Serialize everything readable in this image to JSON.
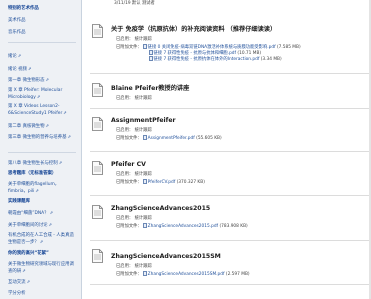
{
  "sidebar": {
    "items": [
      {
        "label": "特别的艺术作品",
        "heading": true,
        "ext": false
      },
      {
        "label": "美术作品",
        "heading": false,
        "ext": false
      },
      {
        "label": "音乐作品",
        "heading": false,
        "ext": false
      },
      {
        "label": "绪论",
        "heading": false,
        "ext": true
      },
      {
        "label": "绪论 视频",
        "heading": false,
        "ext": true
      },
      {
        "label": "第一章 微生物形态",
        "heading": false,
        "ext": true
      },
      {
        "label": "第 X 章 Pfeifer: Molecular Microbiology",
        "heading": false,
        "ext": true
      },
      {
        "label": "第 X 章 Videos Lesson2-6&ScienceStudy1 Pfeifer",
        "heading": false,
        "ext": true
      },
      {
        "label": "第二章 真核微生物",
        "heading": false,
        "ext": true
      },
      {
        "label": "第三章 微生物的营养与培养基",
        "heading": false,
        "ext": true
      },
      {
        "label": "第八章 微生物生长与控制",
        "heading": false,
        "ext": true
      },
      {
        "label": "思考题库（无标准答案）",
        "heading": true,
        "ext": false
      },
      {
        "label": "关于单细胞的flagellum，fimbria，pili",
        "heading": false,
        "ext": true
      },
      {
        "label": "实践课题库",
        "heading": true,
        "ext": false
      },
      {
        "label": "朝霞由“细菌”DNA？",
        "heading": false,
        "ext": true
      },
      {
        "label": "关于单细胞间的讨论",
        "heading": false,
        "ext": true
      },
      {
        "label": "有机合成的在人工合成 - 人类真造生物是否一步？",
        "heading": false,
        "ext": true
      },
      {
        "label": "你的我的高兴“花絮”",
        "heading": true,
        "ext": false
      },
      {
        "label": "关于微生物研究领域与现行应用调查的研",
        "heading": false,
        "ext": true
      },
      {
        "label": "互动交流",
        "heading": false,
        "ext": true
      },
      {
        "label": "学分分析",
        "heading": false,
        "ext": false
      }
    ]
  },
  "main": {
    "date_line": "3/11/19 默认 测试者",
    "entries": [
      {
        "title": "关于 免疫学（抗原抗体）的补充阅读资料 （推荐仔细读读）",
        "status_label": "已启用：",
        "status_value": "统计跟踪",
        "attach_label": "已附加文件：",
        "files": [
          {
            "name": "链接 0 关闭免疫-病毒双链DNA激活补体系统与质膜功能受影响.pdf",
            "size": "(7.585 MB)"
          },
          {
            "name": "链接 7 获得性免疫 - 抗原与抗体和细胞.pdf",
            "size": "(10.71 MB)"
          },
          {
            "name": "链接 7 获得性免疫 - 抗原抗体在体外的Interaction.pdf",
            "size": "(3.34 MB)"
          }
        ]
      },
      {
        "title": "Blaine Pfeifer教授的讲座",
        "status_label": "已启用：",
        "status_value": "统计跟踪",
        "attach_label": "",
        "files": []
      },
      {
        "title": "AssignmentPfeifer",
        "status_label": "已启用：",
        "status_value": "统计跟踪",
        "attach_label": "已附加文件：",
        "files": [
          {
            "name": "AssignmentPfeifer.pdf",
            "size": "(55.605 KB)"
          }
        ]
      },
      {
        "title": "Pfeifer CV",
        "status_label": "已启用：",
        "status_value": "统计跟踪",
        "attach_label": "已附加文件：",
        "files": [
          {
            "name": "PfeiferCV.pdf",
            "size": "(370.327 KB)"
          }
        ]
      },
      {
        "title": "ZhangScienceAdvances2015",
        "status_label": "已启用：",
        "status_value": "统计跟踪",
        "attach_label": "已附加文件：",
        "files": [
          {
            "name": "ZhangScienceAdvances2015.pdf",
            "size": "(783.908 KB)"
          }
        ]
      },
      {
        "title": "ZhangScienceAdvances2015SM",
        "status_label": "已启用：",
        "status_value": "统计跟踪",
        "attach_label": "已附加文件：",
        "files": [
          {
            "name": "ZhangScienceAdvances2015SM.pdf",
            "size": "(2.597 MB)"
          }
        ]
      }
    ]
  },
  "colors": {
    "sidebar_bg": "#eef1f5",
    "link": "#1f4f9a",
    "heading": "#0b3d91"
  }
}
